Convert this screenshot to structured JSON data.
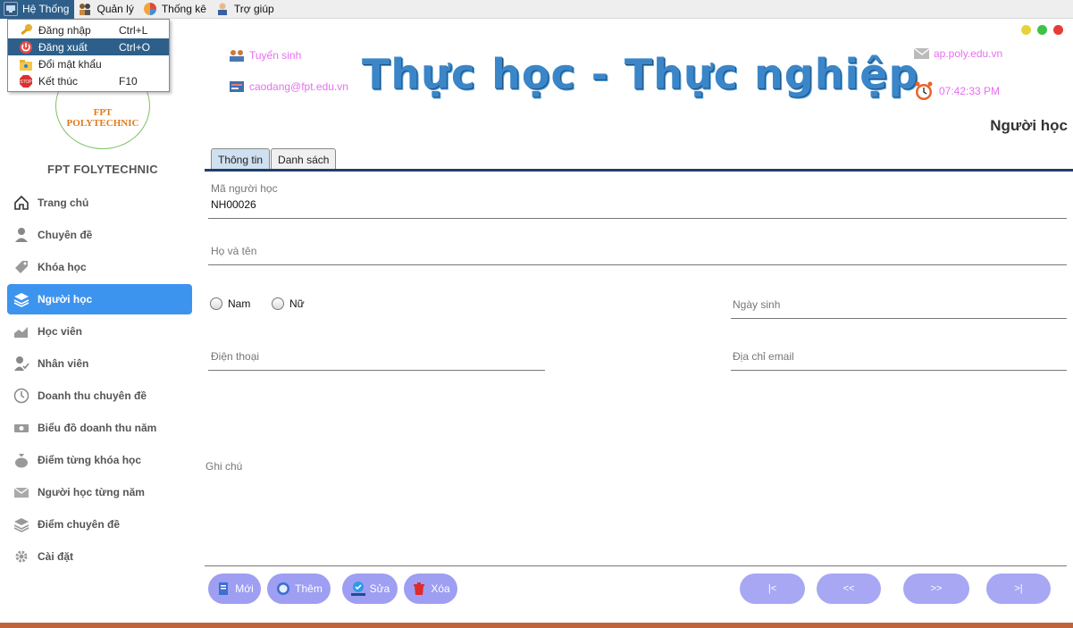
{
  "menubar": {
    "items": [
      {
        "label": "Hệ Thống",
        "icon": "monitor-icon"
      },
      {
        "label": "Quản lý",
        "icon": "people-icon"
      },
      {
        "label": "Thống kê",
        "icon": "chart-icon"
      },
      {
        "label": "Trợ giúp",
        "icon": "support-icon"
      }
    ]
  },
  "dropdown": {
    "items": [
      {
        "label": "Đăng nhập",
        "shortcut": "Ctrl+L",
        "icon": "key-icon"
      },
      {
        "label": "Đăng xuất",
        "shortcut": "Ctrl+O",
        "icon": "power-icon"
      },
      {
        "label": "Đổi mật khẩu",
        "shortcut": "",
        "icon": "folder-key-icon"
      },
      {
        "label": "Kết thúc",
        "shortcut": "F10",
        "icon": "stop-icon"
      }
    ]
  },
  "logo": {
    "text": "FPT POLYTECHNIC"
  },
  "brand": {
    "name": "FPT FOLYTECHNIC"
  },
  "sidebar": {
    "items": [
      {
        "label": "Trang chủ",
        "icon": "home-icon"
      },
      {
        "label": "Chuyên đề",
        "icon": "user-icon"
      },
      {
        "label": "Khóa học",
        "icon": "tag-icon"
      },
      {
        "label": "Người học",
        "icon": "layers-icon"
      },
      {
        "label": "Học viên",
        "icon": "area-chart-icon"
      },
      {
        "label": "Nhân viên",
        "icon": "user-check-icon"
      },
      {
        "label": "Doanh thu chuyên đề",
        "icon": "clock-icon"
      },
      {
        "label": "Biểu đồ doanh thu năm",
        "icon": "money-icon"
      },
      {
        "label": "Điểm từng khóa học",
        "icon": "money-bag-icon"
      },
      {
        "label": "Người học từng năm",
        "icon": "mail-icon"
      },
      {
        "label": "Điểm chuyên đề",
        "icon": "stack-icon"
      },
      {
        "label": "Cài đặt",
        "icon": "gear-icon"
      }
    ],
    "active_index": 3
  },
  "header": {
    "admissions": "Tuyển sinh",
    "email": "caodang@fpt.edu.vn",
    "banner": "Thực học - Thực nghiệp",
    "website": "ap.poly.edu.vn",
    "clock": "07:42:33 PM",
    "page_title": "Người học",
    "accent": "#e66ff0"
  },
  "tabs": [
    {
      "label": "Thông tin",
      "active": true
    },
    {
      "label": "Danh sách",
      "active": false
    }
  ],
  "form": {
    "id_label": "Mã người học",
    "id_value": "NH00026",
    "name_label": "Họ và tên",
    "name_value": "",
    "gender_male": "Nam",
    "gender_female": "Nữ",
    "dob_label": "Ngày sinh",
    "phone_label": "Điện thoại",
    "email_label": "Địa chỉ email",
    "note_label": "Ghi chú"
  },
  "actions": {
    "new": "Mới",
    "add": "Thêm",
    "edit": "Sửa",
    "delete": "Xóa"
  },
  "navigation": {
    "first": "|<",
    "prev": "<<",
    "next": ">>",
    "last": ">|"
  },
  "colors": {
    "active_sidebar": "#3d94ee",
    "button": "#9e9ef2",
    "menu_highlight": "#2d5f8a"
  }
}
